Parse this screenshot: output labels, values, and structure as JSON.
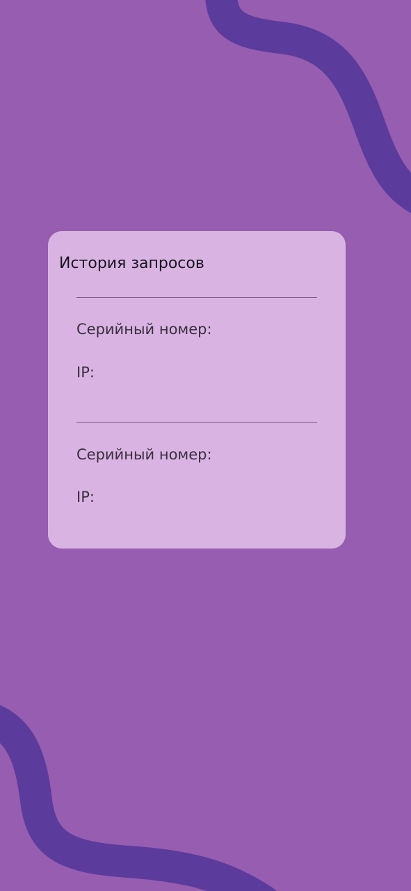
{
  "colors": {
    "background": "#965db0",
    "card": "#d9b4e2",
    "wave": "#5b3b9c",
    "divider": "#7a5c86"
  },
  "history_card": {
    "title": "История запросов",
    "entries": [
      {
        "serial_label": "Серийный номер:",
        "ip_label": "IP:"
      },
      {
        "serial_label": "Серийный номер:",
        "ip_label": "IP:"
      }
    ]
  }
}
